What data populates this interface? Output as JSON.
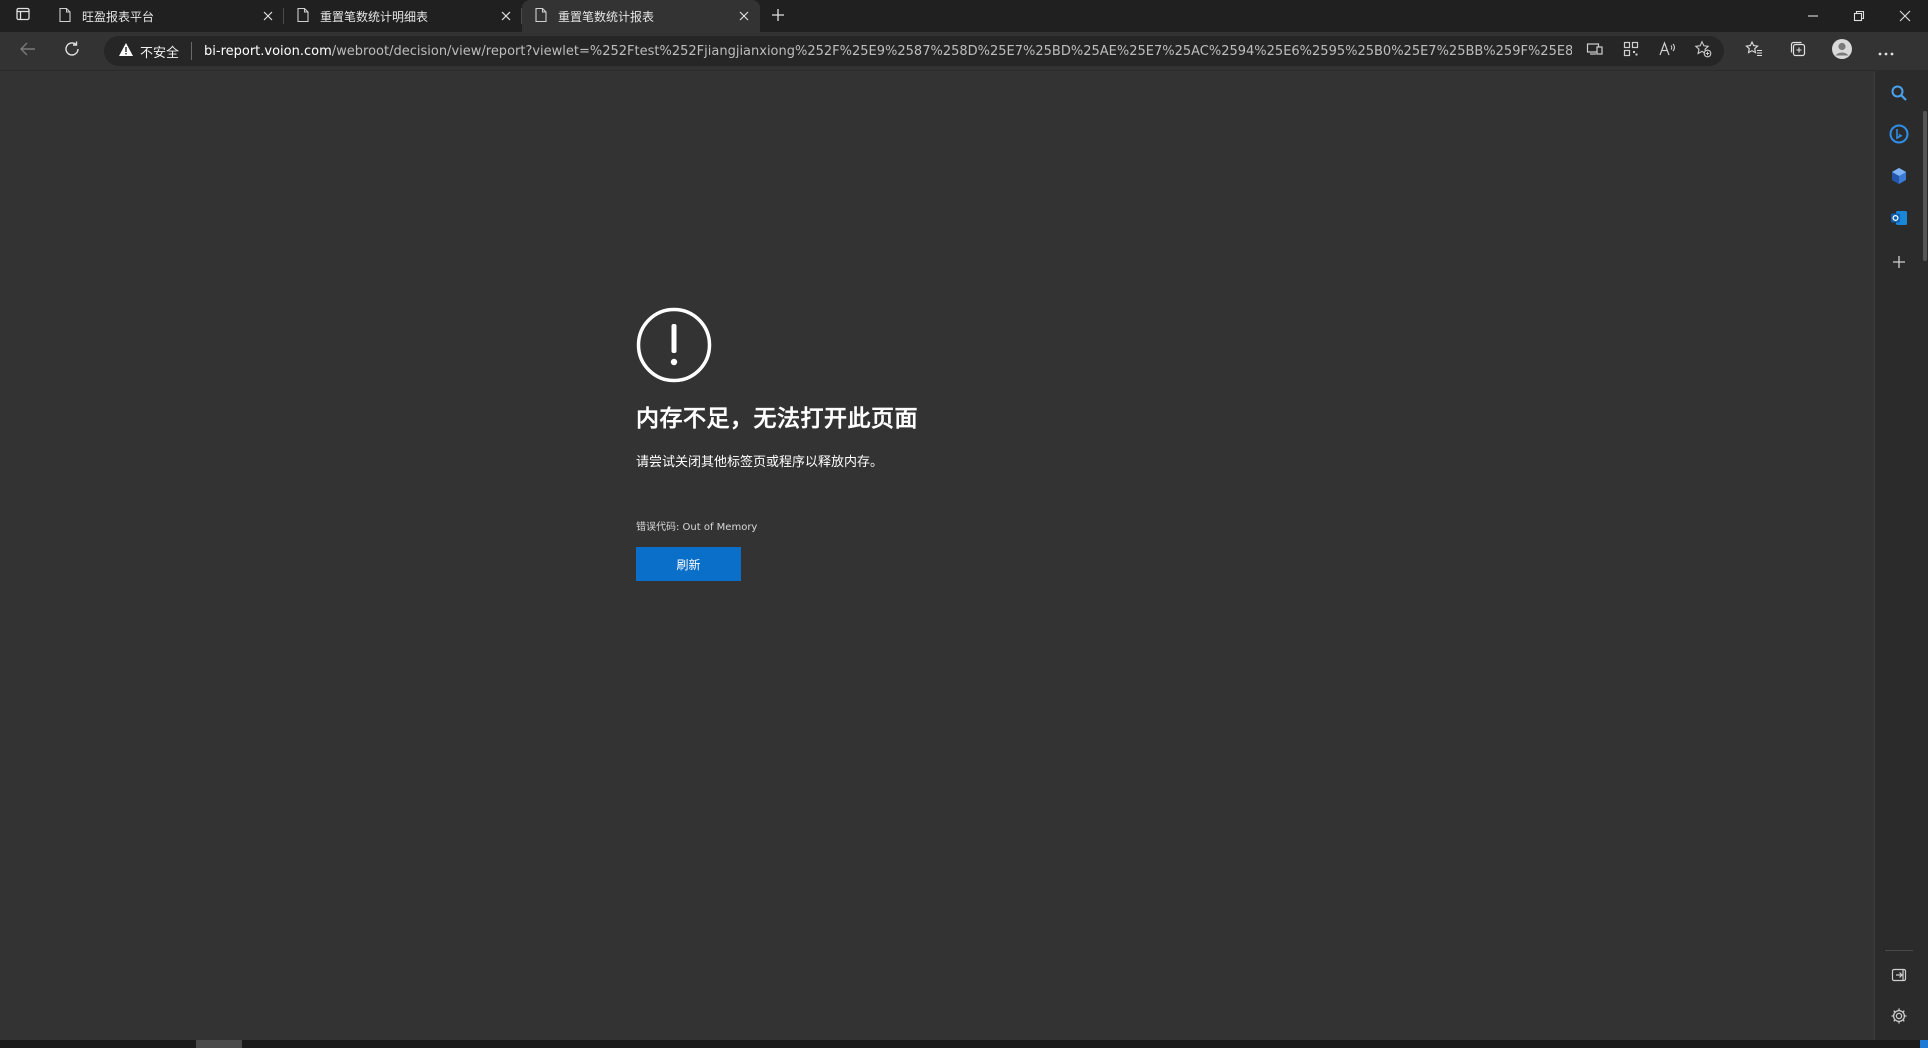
{
  "tabs": [
    {
      "title": "旺盈报表平台",
      "active": false
    },
    {
      "title": "重置笔数统计明细表",
      "active": false
    },
    {
      "title": "重置笔数统计报表",
      "active": true
    }
  ],
  "address_bar": {
    "security_label": "不安全",
    "url_host": "bi-report.voion.com",
    "url_path": "/webroot/decision/view/report?viewlet=%252Ftest%252Fjiangjianxiong%252F%25E9%2587%258D%25E7%25BD%25AE%25E7%25AC%2594%25E6%2595%25B0%25E7%25BB%259F%25E8%25AE%25A..."
  },
  "error_page": {
    "title": "内存不足，无法打开此页面",
    "description": "请尝试关闭其他标签页或程序以释放内存。",
    "error_code": "错误代码: Out of Memory",
    "refresh_label": "刷新"
  },
  "colors": {
    "background": "#333333",
    "tabstrip": "#202020",
    "accent": "#0a6fc8"
  }
}
